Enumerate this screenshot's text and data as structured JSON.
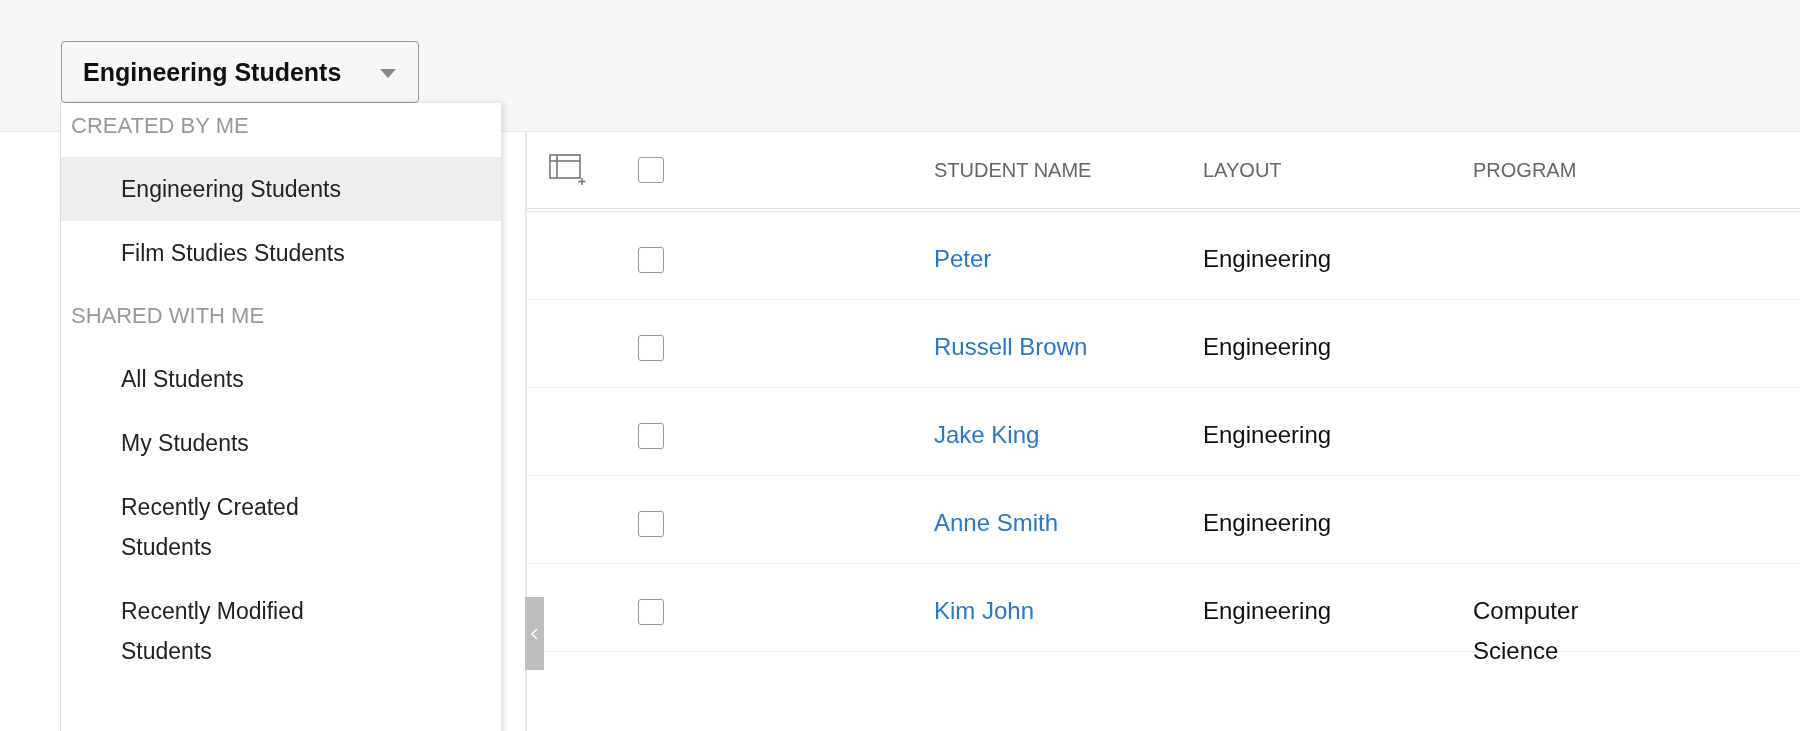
{
  "view_selector": {
    "label": "Engineering Students",
    "expanded": true
  },
  "view_menu": {
    "sections": [
      {
        "heading": "CREATED BY ME",
        "items": [
          {
            "label": "Engineering Students",
            "selected": true
          },
          {
            "label": "Film Studies Students",
            "selected": false
          }
        ]
      },
      {
        "heading": "SHARED WITH ME",
        "items": [
          {
            "label": "All Students",
            "selected": false
          },
          {
            "label": "My Students",
            "selected": false
          },
          {
            "label": "Recently Created Students",
            "selected": false
          },
          {
            "label": "Recently Modified Students",
            "selected": false
          }
        ]
      }
    ]
  },
  "table": {
    "columns": [
      "STUDENT NAME",
      "LAYOUT",
      "PROGRAM"
    ],
    "select_all_checked": false,
    "rows": [
      {
        "student_name": "Peter",
        "layout": "Engineering",
        "checked": false
      },
      {
        "student_name": "Russell Brown",
        "layout": "Engineering",
        "checked": false
      },
      {
        "student_name": "Jake King",
        "layout": "Engineering",
        "checked": false
      },
      {
        "student_name": "Anne Smith",
        "layout": "Engineering",
        "checked": false
      },
      {
        "student_name": "Kim John",
        "layout": "Engineering",
        "program": "Computer Science",
        "checked": false
      }
    ]
  }
}
